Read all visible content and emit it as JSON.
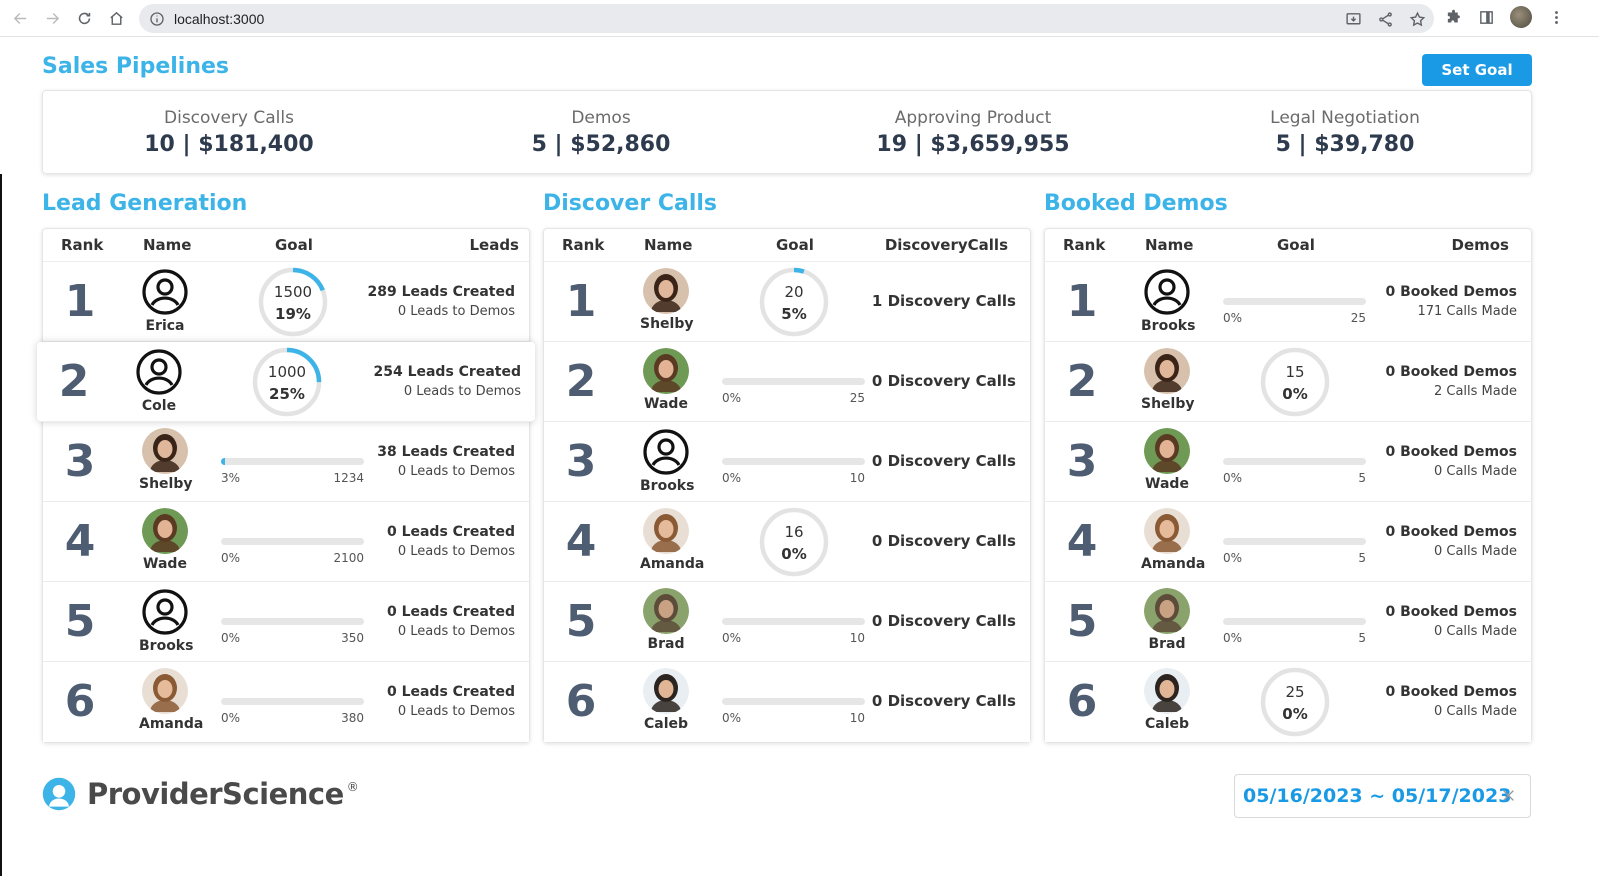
{
  "browser": {
    "url": "localhost:3000"
  },
  "page": {
    "title": "Sales Pipelines",
    "set_goal_label": "Set Goal"
  },
  "summary": [
    {
      "label": "Discovery Calls",
      "value": "10 | $181,400"
    },
    {
      "label": "Demos",
      "value": "5 | $52,860"
    },
    {
      "label": "Approving Product",
      "value": "19 | $3,659,955"
    },
    {
      "label": "Legal Negotiation",
      "value": "5 | $39,780"
    }
  ],
  "lead_generation": {
    "title": "Lead Generation",
    "headers": {
      "rank": "Rank",
      "name": "Name",
      "goal": "Goal",
      "stat": "Leads"
    },
    "rows": [
      {
        "rank": "1",
        "name": "Erica",
        "avatar": "user-icon",
        "goal_type": "ring",
        "goal": "1500",
        "pct": "19%",
        "progress": 0.19,
        "stat1": "289 Leads Created",
        "stat2": "0 Leads to Demos"
      },
      {
        "rank": "2",
        "name": "Cole",
        "avatar": "user-icon",
        "goal_type": "ring",
        "goal": "1000",
        "pct": "25%",
        "progress": 0.25,
        "stat1": "254 Leads Created",
        "stat2": "0 Leads to Demos"
      },
      {
        "rank": "3",
        "name": "Shelby",
        "avatar": "photo-shelby",
        "goal_type": "bar",
        "goal": "1234",
        "pct": "3%",
        "progress": 0.03,
        "stat1": "38 Leads Created",
        "stat2": "0 Leads to Demos"
      },
      {
        "rank": "4",
        "name": "Wade",
        "avatar": "photo-wade",
        "goal_type": "bar",
        "goal": "2100",
        "pct": "0%",
        "progress": 0,
        "stat1": "0 Leads Created",
        "stat2": "0 Leads to Demos"
      },
      {
        "rank": "5",
        "name": "Brooks",
        "avatar": "user-icon",
        "goal_type": "bar",
        "goal": "350",
        "pct": "0%",
        "progress": 0,
        "stat1": "0 Leads Created",
        "stat2": "0 Leads to Demos"
      },
      {
        "rank": "6",
        "name": "Amanda",
        "avatar": "photo-amanda",
        "goal_type": "bar",
        "goal": "380",
        "pct": "0%",
        "progress": 0,
        "stat1": "0 Leads Created",
        "stat2": "0 Leads to Demos"
      }
    ]
  },
  "discover_calls": {
    "title": "Discover Calls",
    "headers": {
      "rank": "Rank",
      "name": "Name",
      "goal": "Goal",
      "stat": "DiscoveryCalls"
    },
    "rows": [
      {
        "rank": "1",
        "name": "Shelby",
        "avatar": "photo-shelby",
        "goal_type": "ring",
        "goal": "20",
        "pct": "5%",
        "progress": 0.05,
        "stat1": "1 Discovery Calls"
      },
      {
        "rank": "2",
        "name": "Wade",
        "avatar": "photo-wade",
        "goal_type": "bar",
        "goal": "25",
        "pct": "0%",
        "progress": 0,
        "stat1": "0 Discovery Calls"
      },
      {
        "rank": "3",
        "name": "Brooks",
        "avatar": "user-icon",
        "goal_type": "bar",
        "goal": "10",
        "pct": "0%",
        "progress": 0,
        "stat1": "0 Discovery Calls"
      },
      {
        "rank": "4",
        "name": "Amanda",
        "avatar": "photo-amanda",
        "goal_type": "ring",
        "goal": "16",
        "pct": "0%",
        "progress": 0,
        "stat1": "0 Discovery Calls"
      },
      {
        "rank": "5",
        "name": "Brad",
        "avatar": "photo-brad",
        "goal_type": "bar",
        "goal": "10",
        "pct": "0%",
        "progress": 0,
        "stat1": "0 Discovery Calls"
      },
      {
        "rank": "6",
        "name": "Caleb",
        "avatar": "photo-caleb",
        "goal_type": "bar",
        "goal": "10",
        "pct": "0%",
        "progress": 0,
        "stat1": "0 Discovery Calls"
      }
    ]
  },
  "booked_demos": {
    "title": "Booked Demos",
    "headers": {
      "rank": "Rank",
      "name": "Name",
      "goal": "Goal",
      "stat": "Demos"
    },
    "rows": [
      {
        "rank": "1",
        "name": "Brooks",
        "avatar": "user-icon",
        "goal_type": "bar",
        "goal": "25",
        "pct": "0%",
        "progress": 0,
        "stat1": "0 Booked Demos",
        "stat2": "171 Calls Made"
      },
      {
        "rank": "2",
        "name": "Shelby",
        "avatar": "photo-shelby",
        "goal_type": "ring",
        "goal": "15",
        "pct": "0%",
        "progress": 0,
        "stat1": "0 Booked Demos",
        "stat2": "2 Calls Made"
      },
      {
        "rank": "3",
        "name": "Wade",
        "avatar": "photo-wade",
        "goal_type": "bar",
        "goal": "5",
        "pct": "0%",
        "progress": 0,
        "stat1": "0 Booked Demos",
        "stat2": "0 Calls Made"
      },
      {
        "rank": "4",
        "name": "Amanda",
        "avatar": "photo-amanda",
        "goal_type": "bar",
        "goal": "5",
        "pct": "0%",
        "progress": 0,
        "stat1": "0 Booked Demos",
        "stat2": "0 Calls Made"
      },
      {
        "rank": "5",
        "name": "Brad",
        "avatar": "photo-brad",
        "goal_type": "bar",
        "goal": "5",
        "pct": "0%",
        "progress": 0,
        "stat1": "0 Booked Demos",
        "stat2": "0 Calls Made"
      },
      {
        "rank": "6",
        "name": "Caleb",
        "avatar": "photo-caleb",
        "goal_type": "ring",
        "goal": "25",
        "pct": "0%",
        "progress": 0,
        "stat1": "0 Booked Demos",
        "stat2": "0 Calls Made"
      }
    ]
  },
  "footer": {
    "brand": "ProviderScience",
    "brand_mark": "®",
    "date_range": "05/16/2023 ~ 05/17/2023"
  },
  "colors": {
    "accent": "#3db4e8",
    "button": "#1a9ae4",
    "rank": "#4f5d73",
    "track": "#e6e6e6"
  }
}
